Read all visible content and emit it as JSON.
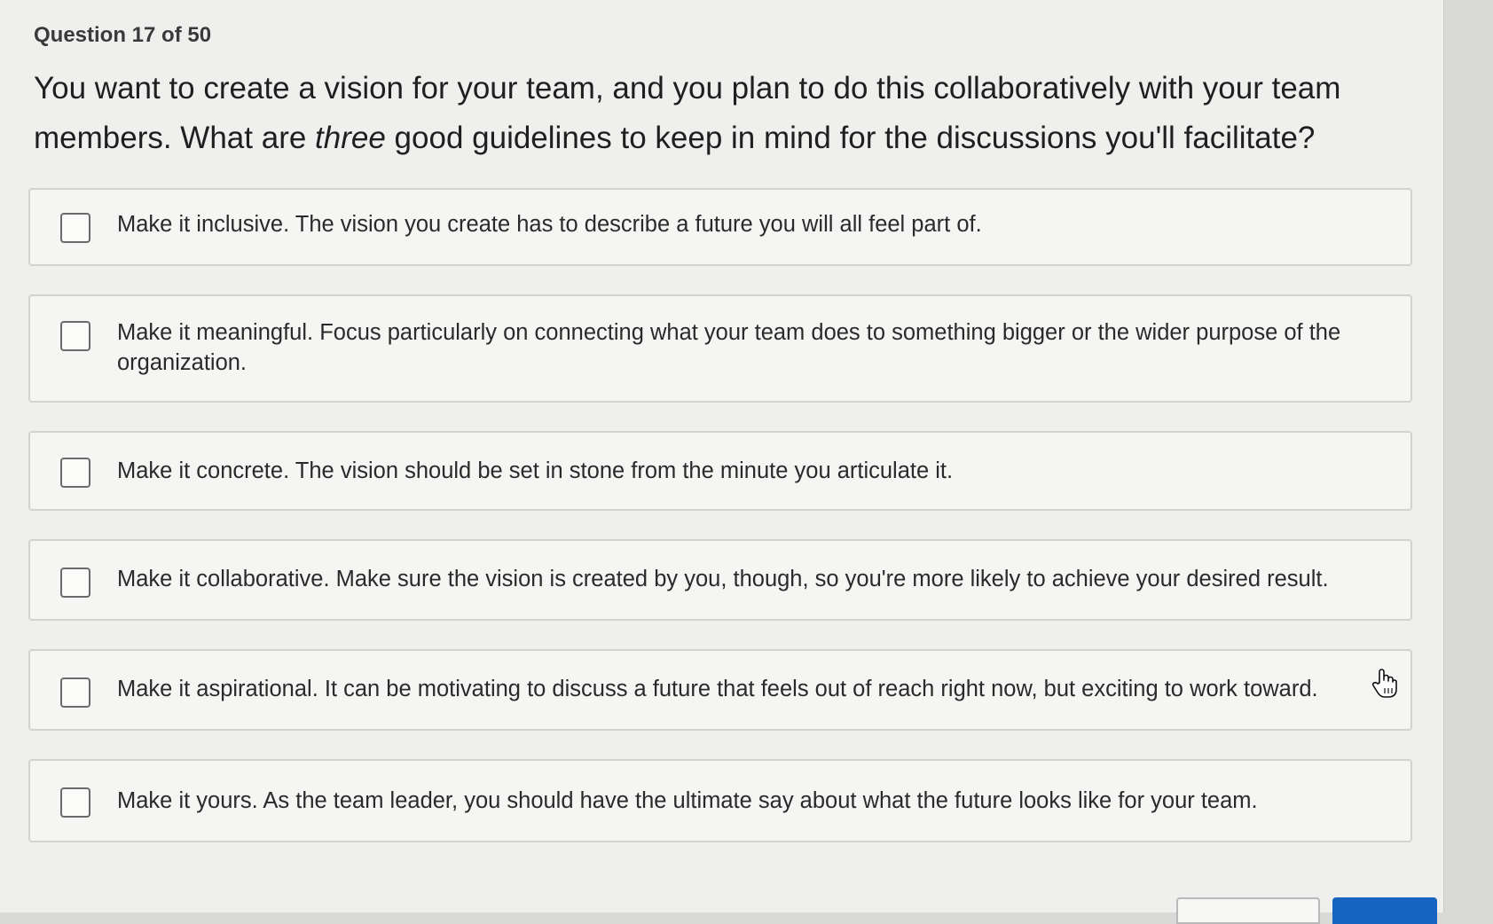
{
  "quiz": {
    "counter": "Question 17 of 50",
    "question_part1": "You want to create a vision for your team, and you plan to do this collaboratively with your team members. What are ",
    "question_emphasis": "three",
    "question_part2": " good guidelines to keep in mind for the discussions you'll facilitate?",
    "options": [
      {
        "text": "Make it inclusive. The vision you create has to describe a future you will all feel part of.",
        "checked": false
      },
      {
        "text": "Make it meaningful. Focus particularly on connecting what your team does to something bigger or the wider purpose of the organization.",
        "checked": false
      },
      {
        "text": "Make it concrete. The vision should be set in stone from the minute you articulate it.",
        "checked": false
      },
      {
        "text": "Make it collaborative. Make sure the vision is created by you, though, so you're more likely to achieve your desired result.",
        "checked": false
      },
      {
        "text": "Make it aspirational. It can be motivating to discuss a future that feels out of reach right now, but exciting to work toward.",
        "checked": false
      },
      {
        "text": "Make it yours. As the team leader, you should have the ultimate say about what the future looks like for your team.",
        "checked": false
      }
    ]
  },
  "colors": {
    "primary_button": "#1565c0",
    "page_background": "#efefed"
  },
  "icons": {
    "cursor": "hand-pointer-icon",
    "checkbox": "checkbox-icon"
  }
}
